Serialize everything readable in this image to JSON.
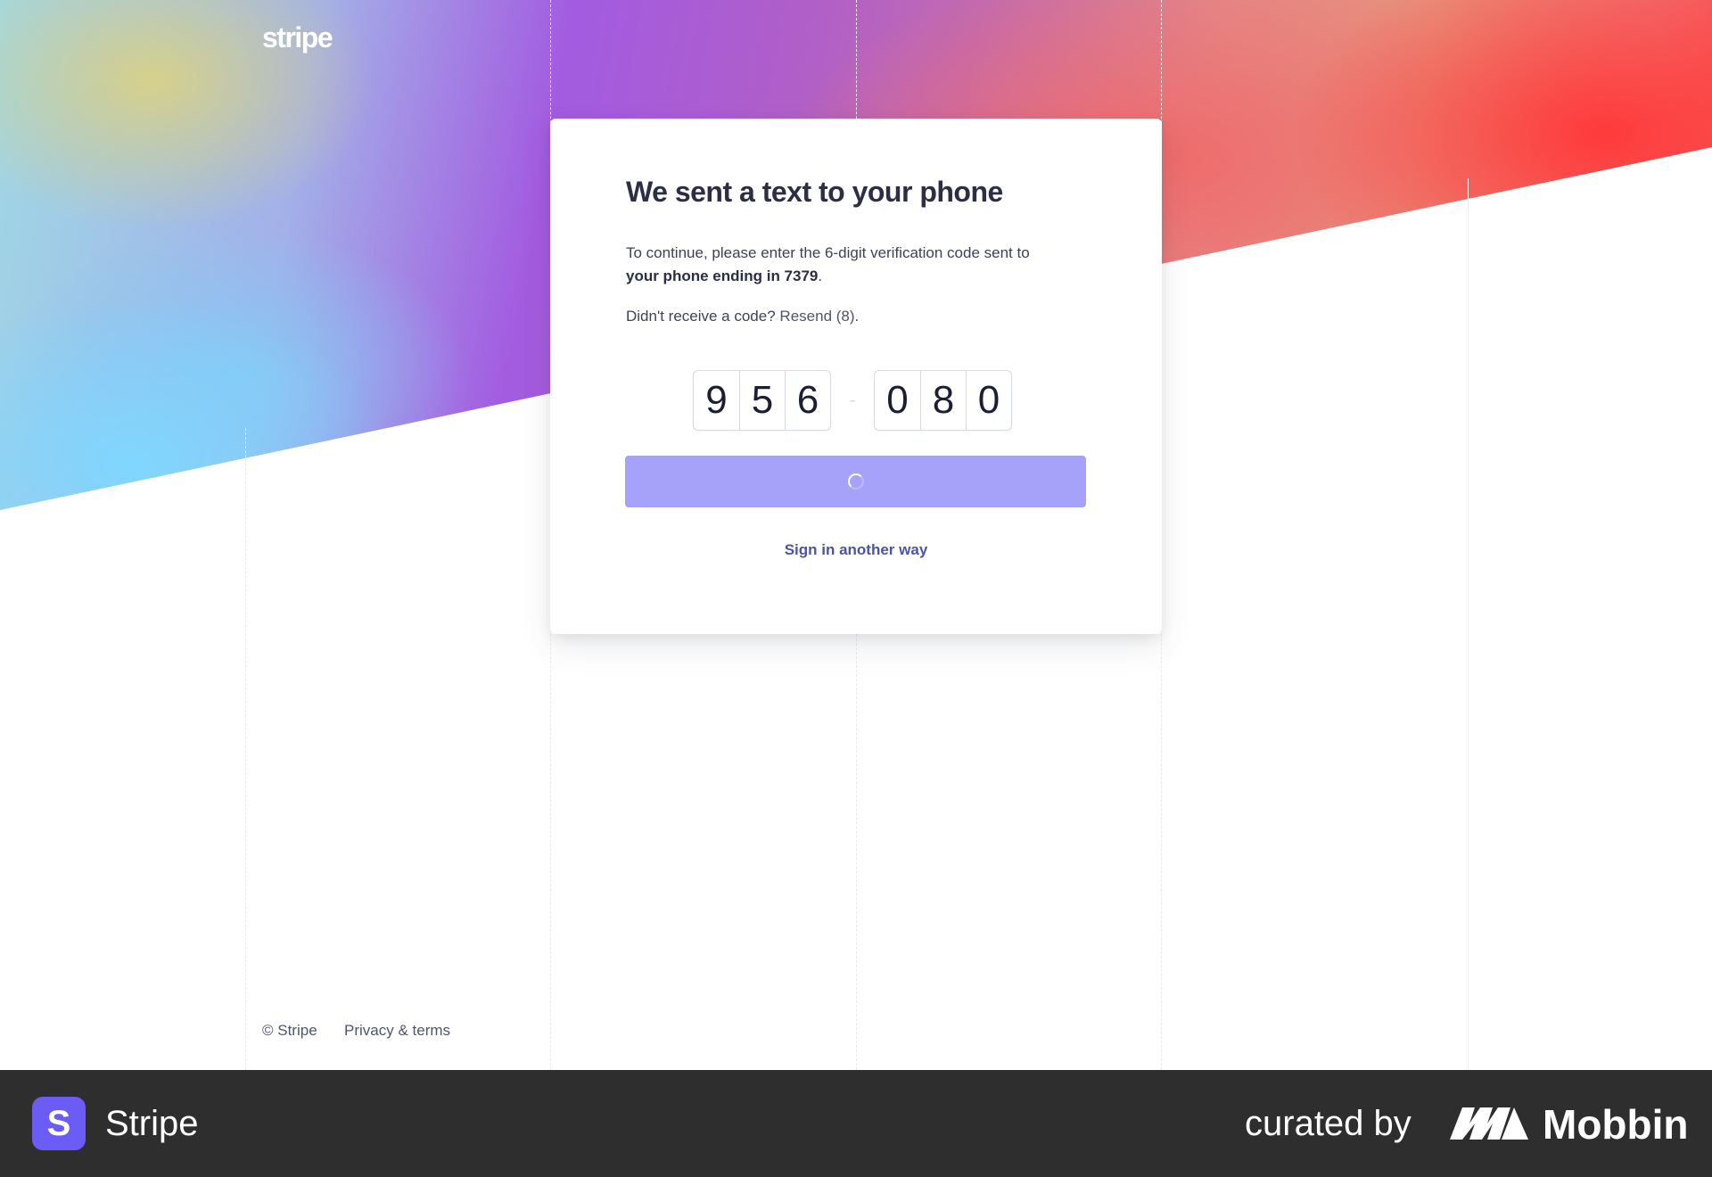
{
  "brand": {
    "logo_text": "stripe"
  },
  "card": {
    "title": "We sent a text to your phone",
    "description_prefix": "To continue, please enter the 6-digit verification code sent to",
    "description_bold": "your phone ending in 7379",
    "description_suffix": ".",
    "resend_prompt": "Didn't receive a code?",
    "resend_link": "Resend (8)",
    "resend_suffix": ".",
    "code_digits_first": [
      "9",
      "5",
      "6"
    ],
    "code_separator": "-",
    "code_digits_second": [
      "0",
      "8",
      "0"
    ],
    "submit_state": "loading",
    "alt_signin_link": "Sign in another way"
  },
  "footer": {
    "copyright": "© Stripe",
    "privacy_link": "Privacy & terms"
  },
  "bottom_bar": {
    "app_icon_letter": "S",
    "app_name": "Stripe",
    "curated_by": "curated by",
    "curator_name": "Mobbin"
  },
  "colors": {
    "button": "#a6a2fa",
    "link": "#4a55a0",
    "bottom_bar": "#2e2e2e",
    "app_icon": "#6a5cf5"
  },
  "icons": [
    "spinner-icon",
    "mobbin-logo-icon"
  ]
}
